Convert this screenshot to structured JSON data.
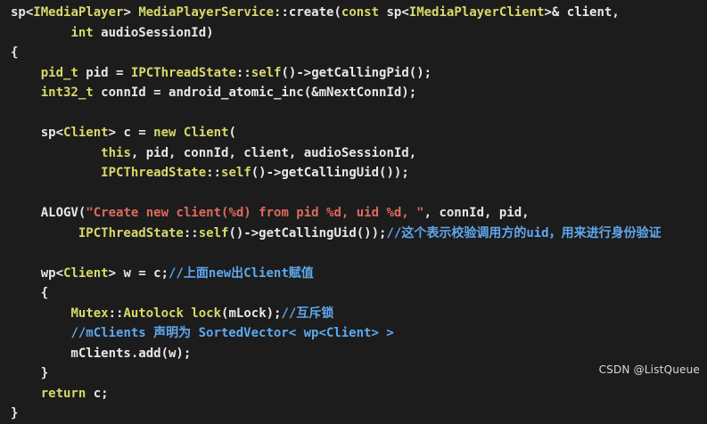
{
  "colors": {
    "background": "#1c1c1c",
    "plain": "#e8e8e8",
    "type": "#d7d96a",
    "string": "#e06a5c",
    "comment": "#5fa8ee"
  },
  "code": {
    "lines": [
      {
        "tokens": [
          {
            "k": "plain",
            "t": "sp<"
          },
          {
            "k": "class",
            "t": "IMediaPlayer"
          },
          {
            "k": "plain",
            "t": "> "
          },
          {
            "k": "class",
            "t": "MediaPlayerService"
          },
          {
            "k": "plain",
            "t": "::create("
          },
          {
            "k": "kw",
            "t": "const"
          },
          {
            "k": "plain",
            "t": " sp<"
          },
          {
            "k": "class",
            "t": "IMediaPlayerClient"
          },
          {
            "k": "plain",
            "t": ">& client,"
          }
        ]
      },
      {
        "tokens": [
          {
            "k": "plain",
            "t": "        "
          },
          {
            "k": "type",
            "t": "int"
          },
          {
            "k": "plain",
            "t": " audioSessionId)"
          }
        ]
      },
      {
        "tokens": [
          {
            "k": "plain",
            "t": "{"
          }
        ]
      },
      {
        "tokens": [
          {
            "k": "plain",
            "t": "    "
          },
          {
            "k": "type",
            "t": "pid_t"
          },
          {
            "k": "plain",
            "t": " pid = "
          },
          {
            "k": "class",
            "t": "IPCThreadState"
          },
          {
            "k": "plain",
            "t": "::"
          },
          {
            "k": "kw",
            "t": "self"
          },
          {
            "k": "plain",
            "t": "()->getCallingPid();"
          }
        ]
      },
      {
        "tokens": [
          {
            "k": "plain",
            "t": "    "
          },
          {
            "k": "type",
            "t": "int32_t"
          },
          {
            "k": "plain",
            "t": " connId = android_atomic_inc(&mNextConnId);"
          }
        ]
      },
      {
        "tokens": [
          {
            "k": "plain",
            "t": ""
          }
        ]
      },
      {
        "tokens": [
          {
            "k": "plain",
            "t": "    sp<"
          },
          {
            "k": "class",
            "t": "Client"
          },
          {
            "k": "plain",
            "t": "> c = "
          },
          {
            "k": "kw",
            "t": "new"
          },
          {
            "k": "plain",
            "t": " "
          },
          {
            "k": "class",
            "t": "Client"
          },
          {
            "k": "plain",
            "t": "("
          }
        ]
      },
      {
        "tokens": [
          {
            "k": "plain",
            "t": "            "
          },
          {
            "k": "kw",
            "t": "this"
          },
          {
            "k": "plain",
            "t": ", pid, connId, client, audioSessionId,"
          }
        ]
      },
      {
        "tokens": [
          {
            "k": "plain",
            "t": "            "
          },
          {
            "k": "class",
            "t": "IPCThreadState"
          },
          {
            "k": "plain",
            "t": "::"
          },
          {
            "k": "kw",
            "t": "self"
          },
          {
            "k": "plain",
            "t": "()->getCallingUid());"
          }
        ]
      },
      {
        "tokens": [
          {
            "k": "plain",
            "t": ""
          }
        ]
      },
      {
        "tokens": [
          {
            "k": "plain",
            "t": "    ALOGV("
          },
          {
            "k": "string",
            "t": "\"Create new client(%d) from pid %d, uid %d, \""
          },
          {
            "k": "plain",
            "t": ", connId, pid,"
          }
        ]
      },
      {
        "tokens": [
          {
            "k": "plain",
            "t": "         "
          },
          {
            "k": "class",
            "t": "IPCThreadState"
          },
          {
            "k": "plain",
            "t": "::"
          },
          {
            "k": "kw",
            "t": "self"
          },
          {
            "k": "plain",
            "t": "()->getCallingUid());"
          },
          {
            "k": "comment",
            "t": "//这个表示校验调用方的uid，用来进行身份验证"
          }
        ]
      },
      {
        "tokens": [
          {
            "k": "plain",
            "t": ""
          }
        ]
      },
      {
        "tokens": [
          {
            "k": "plain",
            "t": "    wp<"
          },
          {
            "k": "class",
            "t": "Client"
          },
          {
            "k": "plain",
            "t": "> w = c;"
          },
          {
            "k": "comment",
            "t": "//上面new出Client赋值"
          }
        ]
      },
      {
        "tokens": [
          {
            "k": "plain",
            "t": "    {"
          }
        ]
      },
      {
        "tokens": [
          {
            "k": "plain",
            "t": "        "
          },
          {
            "k": "class",
            "t": "Mutex"
          },
          {
            "k": "plain",
            "t": "::"
          },
          {
            "k": "class",
            "t": "Autolock"
          },
          {
            "k": "plain",
            "t": " "
          },
          {
            "k": "kw",
            "t": "lock"
          },
          {
            "k": "plain",
            "t": "(mLock);"
          },
          {
            "k": "comment",
            "t": "//互斥锁"
          }
        ]
      },
      {
        "tokens": [
          {
            "k": "plain",
            "t": "        "
          },
          {
            "k": "comment",
            "t": "//mClients 声明为 SortedVector< wp<Client> >"
          }
        ]
      },
      {
        "tokens": [
          {
            "k": "plain",
            "t": "        mClients.add(w);"
          }
        ]
      },
      {
        "tokens": [
          {
            "k": "plain",
            "t": "    }"
          }
        ]
      },
      {
        "tokens": [
          {
            "k": "plain",
            "t": "    "
          },
          {
            "k": "kw",
            "t": "return"
          },
          {
            "k": "plain",
            "t": " c;"
          }
        ]
      },
      {
        "tokens": [
          {
            "k": "plain",
            "t": "}"
          }
        ]
      }
    ]
  },
  "watermark": "CSDN @ListQueue"
}
